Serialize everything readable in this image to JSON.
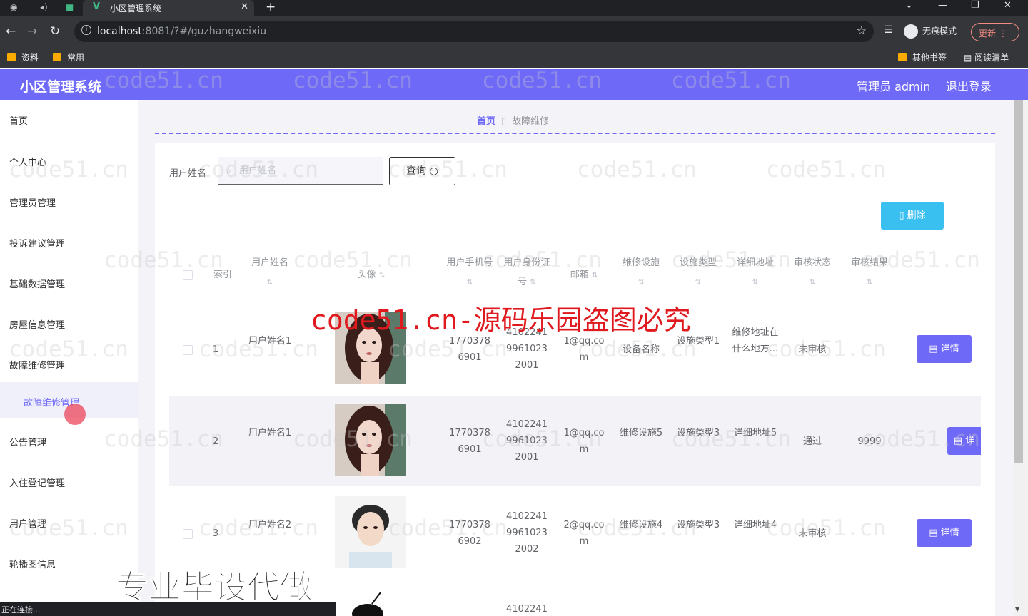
{
  "browser": {
    "tab_title": "小区管理系统",
    "url_host": "localhost",
    "url_path": ":8081/?#/guzhangweixiu",
    "incognito_label": "无痕模式",
    "update_label": "更新",
    "bookmarks": [
      "资料",
      "常用"
    ],
    "bookmarks_right": [
      "其他书签",
      "阅读清单"
    ]
  },
  "header": {
    "title": "小区管理系统",
    "user": "管理员 admin",
    "logout": "退出登录"
  },
  "sidebar": {
    "items": [
      "首页",
      "个人中心",
      "管理员管理",
      "投诉建议管理",
      "基础数据管理",
      "房屋信息管理",
      "故障维修管理"
    ],
    "active_sub": "故障维修管理",
    "items_after": [
      "公告管理",
      "入住登记管理",
      "用户管理",
      "轮播图信息"
    ]
  },
  "breadcrumb": {
    "home": "首页",
    "current": "故障维修"
  },
  "search": {
    "label": "用户姓名",
    "placeholder": "用户姓名",
    "button": "查询"
  },
  "actions": {
    "delete": "删除"
  },
  "table": {
    "headers": {
      "index": "索引",
      "name": "用户姓名",
      "avatar": "头像",
      "phone": "用户手机号",
      "idcard": "用户身份证号",
      "email": "邮箱",
      "facility": "维修设施",
      "type": "设施类型",
      "address": "详细地址",
      "audit_status": "审核状态",
      "audit_result": "审核结果"
    },
    "rows": [
      {
        "index": "1",
        "name": "用户姓名1",
        "phone": "17703786901",
        "idcard": "410224199610232001",
        "email": "1@qq.com",
        "facility": "设备名称",
        "type": "设施类型1",
        "address": "维修地址在什么地方...",
        "audit_status": "未审核",
        "audit_result": "",
        "detail": "详情"
      },
      {
        "index": "2",
        "name": "用户姓名1",
        "phone": "17703786901",
        "idcard": "410224199610232001",
        "email": "1@qq.com",
        "facility": "维修设施5",
        "type": "设施类型3",
        "address": "详细地址5",
        "audit_status": "通过",
        "audit_result": "9999",
        "detail": "详"
      },
      {
        "index": "3",
        "name": "用户姓名2",
        "phone": "17703786902",
        "idcard": "410224199610232002",
        "email": "2@qq.com",
        "facility": "维修设施4",
        "type": "设施类型3",
        "address": "详细地址4",
        "audit_status": "未审核",
        "audit_result": "",
        "detail": "详情"
      },
      {
        "idcard_partial": "4102241"
      }
    ]
  },
  "overlay": {
    "red_text": "code51.cn-源码乐园盗图必究",
    "promo": "专业毕设代做",
    "status": "正在连接...",
    "watermark": "code51.cn"
  },
  "colors": {
    "accent": "#6f69f8",
    "delete": "#39c0f0",
    "red": "#e0191f"
  }
}
